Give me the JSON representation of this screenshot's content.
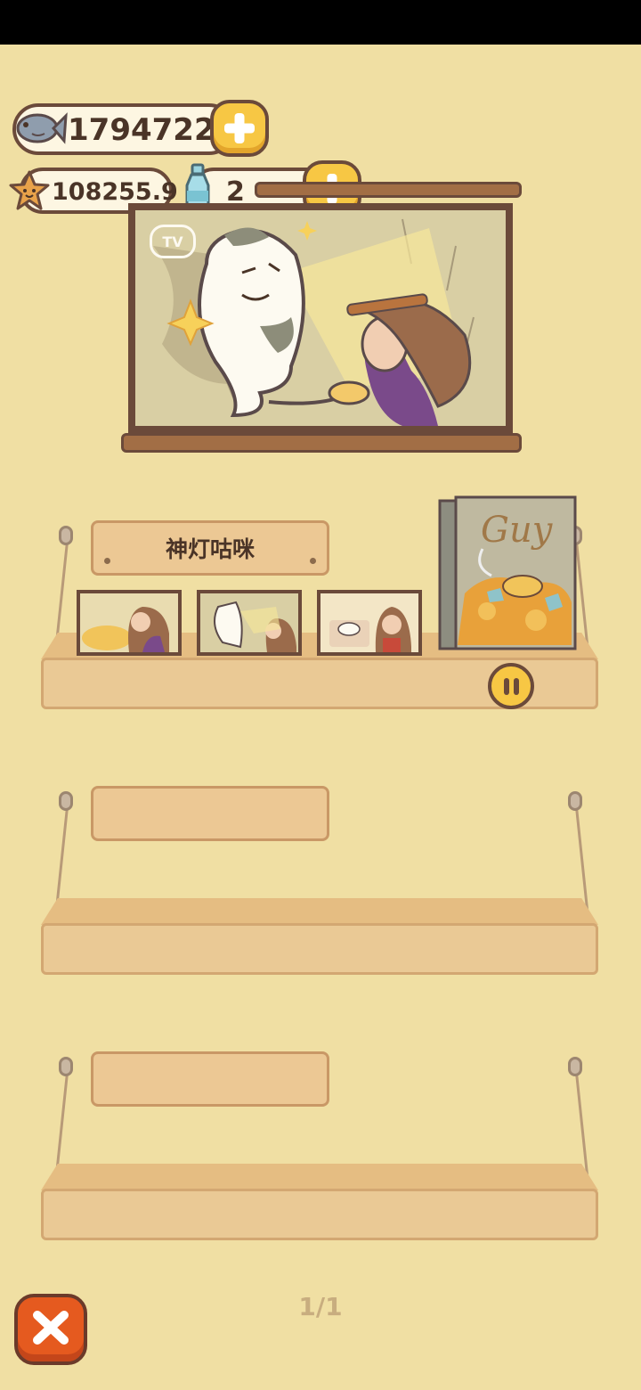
{
  "currency": {
    "fish": {
      "value": "1794722",
      "icon": "fish-icon"
    },
    "stars": {
      "value": "108255.9",
      "icon": "star-icon"
    },
    "bottles": {
      "value": "2",
      "icon": "bottle-icon"
    }
  },
  "tv": {
    "badge": "TV"
  },
  "shelves": [
    {
      "label": "神灯咕咪",
      "cards": 3,
      "has_book": true
    },
    {
      "label": ""
    },
    {
      "label": ""
    }
  ],
  "book": {
    "title": "Guy"
  },
  "pagination": {
    "text": "1/1"
  },
  "colors": {
    "accent": "#f7c744",
    "close": "#e55a1f",
    "background": "#f0dfa3"
  }
}
